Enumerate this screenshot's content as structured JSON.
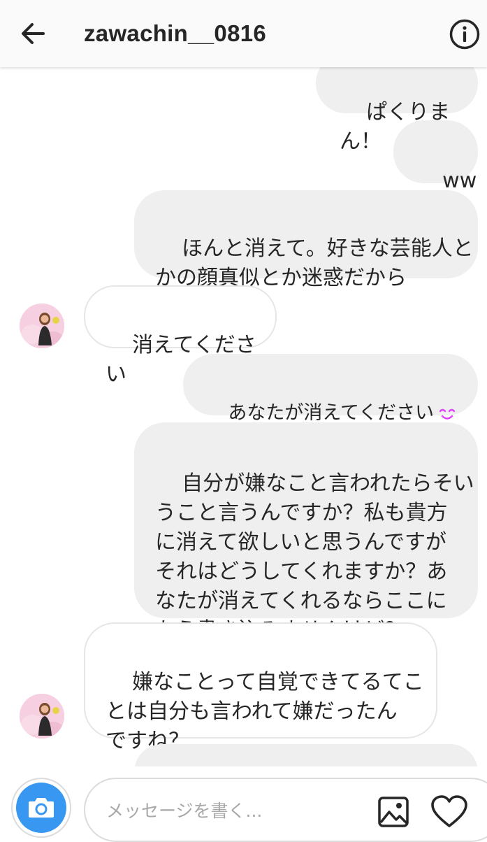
{
  "header": {
    "username": "zawachin__0816",
    "back_icon": "arrow-left-icon",
    "info_icon": "info-icon"
  },
  "messages": [
    {
      "direction": "outgoing",
      "text": "ぱくりまん！"
    },
    {
      "direction": "outgoing",
      "text": "www"
    },
    {
      "direction": "outgoing",
      "text": "ほんと消えて。好きな芸能人と\nかの顔真似とか迷惑だから"
    },
    {
      "direction": "incoming",
      "text": "消えてください"
    },
    {
      "direction": "outgoing",
      "text": "あなたが消えてください",
      "emoji": "smiling-face-icon"
    },
    {
      "direction": "outgoing",
      "text": "自分が嫌なこと言われたらそい\nうこと言うんですか？私も貴方\nに消えて欲しいと思うんですが\nそれはどうしてくれますか？あ\nなたが消えてくれるならここに\nもう書き込みませんけど？"
    },
    {
      "direction": "incoming",
      "text": "嫌なことって自覚できてるてこ\nとは自分も言われて嫌だったん\nですね？"
    }
  ],
  "composer": {
    "placeholder": "メッセージを書く...",
    "camera_icon": "camera-icon",
    "gallery_icon": "gallery-icon",
    "heart_icon": "heart-icon"
  },
  "colors": {
    "header_bg": "#fafafa",
    "outgoing_bubble": "#efefef",
    "incoming_border": "#e6e6e6",
    "camera_blue": "#3897f0",
    "emoji_pink": "#e040fb"
  }
}
